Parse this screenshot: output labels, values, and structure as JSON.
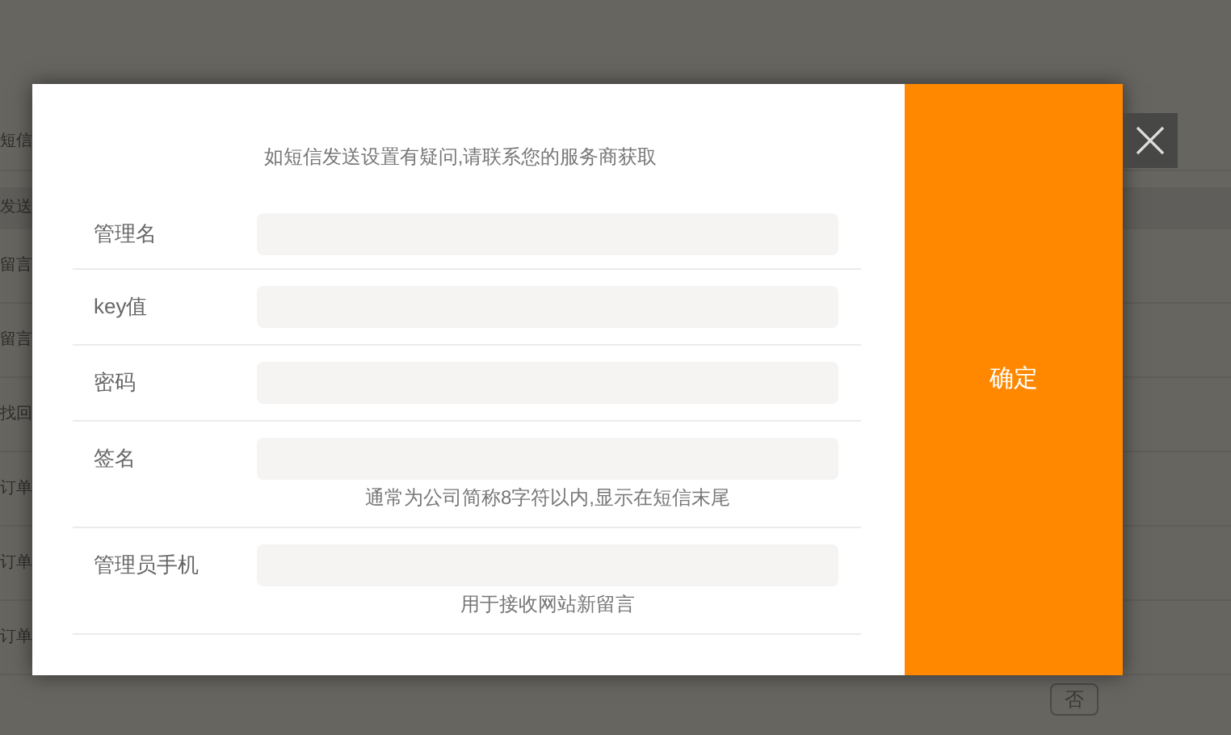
{
  "background": {
    "rows": [
      {
        "label": "短信",
        "kind": "row"
      },
      {
        "label": "发送",
        "kind": "header"
      },
      {
        "label": "留言",
        "kind": "row"
      },
      {
        "label": "留言",
        "kind": "row"
      },
      {
        "label": "找回",
        "kind": "row"
      },
      {
        "label": "订单",
        "kind": "row"
      },
      {
        "label": "订单",
        "kind": "row"
      },
      {
        "label": "订单",
        "kind": "row"
      }
    ],
    "toggle": "否"
  },
  "dialog": {
    "hint": "如短信发送设置有疑问,请联系您的服务商获取",
    "fields": [
      {
        "label": "管理名"
      },
      {
        "label": "key值"
      },
      {
        "label": "密码"
      },
      {
        "label": "签名",
        "note": "通常为公司简称8字符以内,显示在短信末尾"
      },
      {
        "label": "管理员手机",
        "note": "用于接收网站新留言"
      }
    ],
    "confirm": "确定"
  }
}
